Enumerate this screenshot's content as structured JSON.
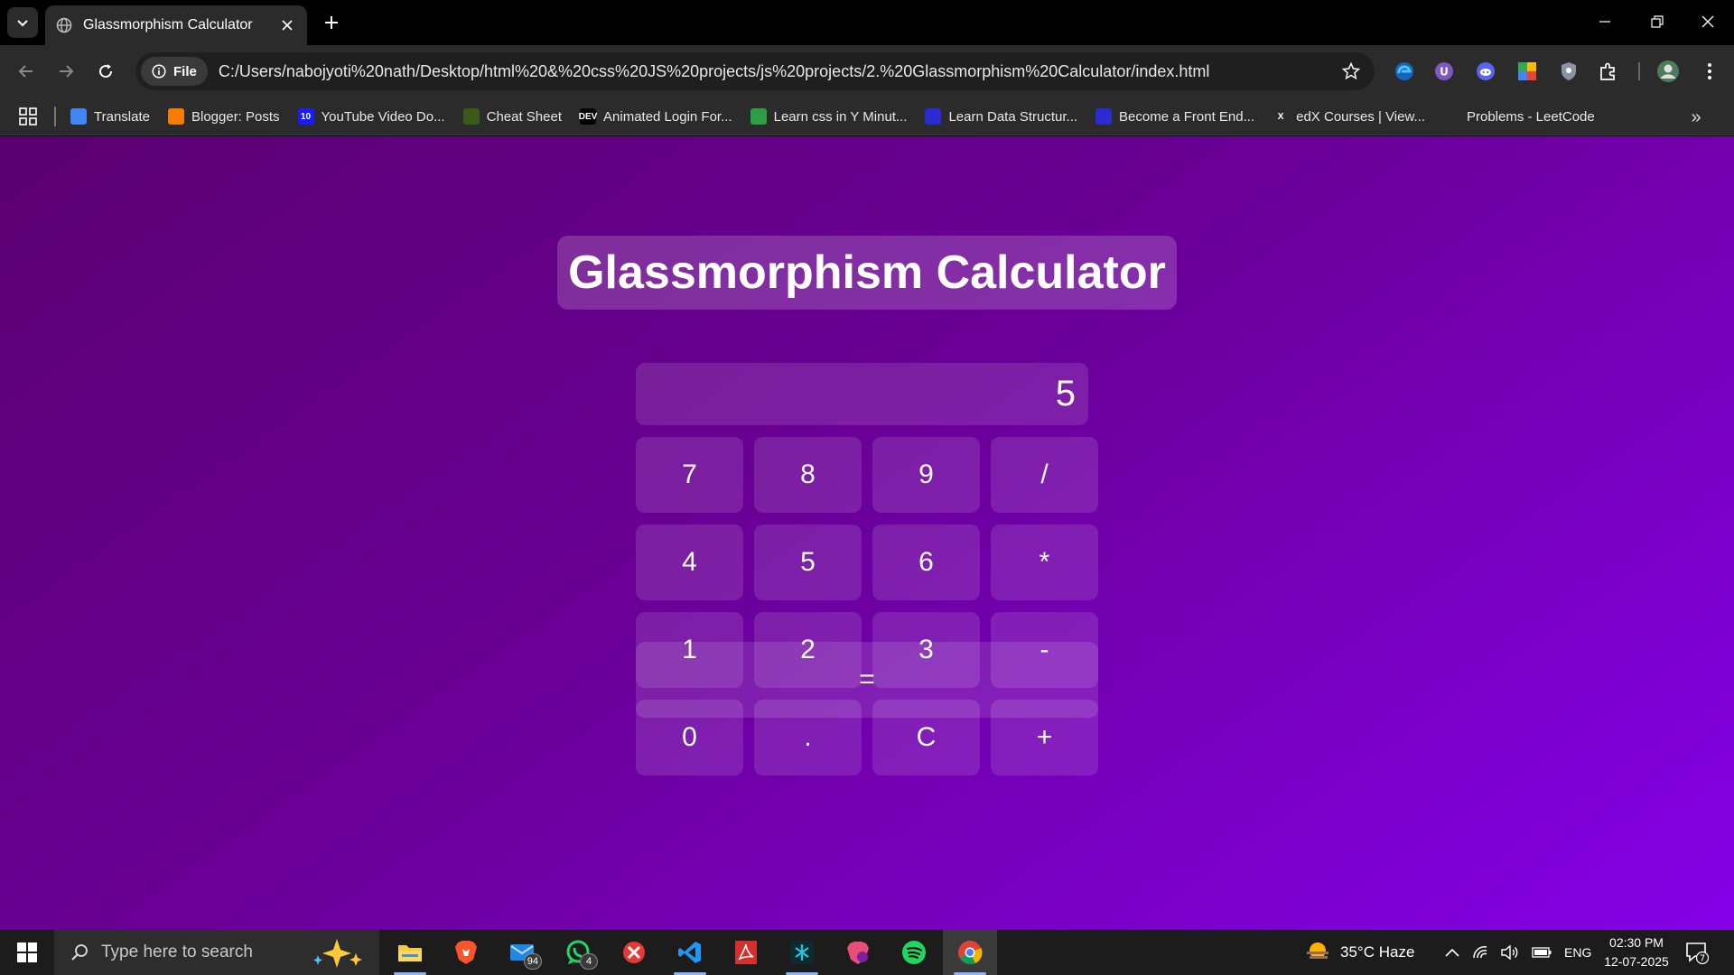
{
  "browser": {
    "tab_title": "Glassmorphism Calculator",
    "site_chip": "File",
    "url": "C:/Users/nabojyoti%20nath/Desktop/html%20&%20css%20JS%20projects/js%20projects/2.%20Glassmorphism%20Calculator/index.html",
    "bookmarks": [
      {
        "label": "Translate",
        "icon": "google-translate-icon",
        "color": "#4285f4"
      },
      {
        "label": "Blogger: Posts",
        "icon": "blogger-icon",
        "color": "#f57d00"
      },
      {
        "label": "YouTube Video Do...",
        "icon": "youtube-downloader-icon",
        "color": "#1a1aff",
        "glyph": "10"
      },
      {
        "label": "Cheat Sheet",
        "icon": "cheat-sheet-icon",
        "color": "#3a5a1a"
      },
      {
        "label": "Animated Login For...",
        "icon": "dev-icon",
        "color": "#000000",
        "glyph": "DEV"
      },
      {
        "label": "Learn css in Y Minut...",
        "icon": "learnxiny-icon",
        "color": "#2e9e44"
      },
      {
        "label": "Learn Data Structur...",
        "icon": "data-structures-icon",
        "color": "#2b2bd4"
      },
      {
        "label": "Become a Front End...",
        "icon": "frontend-icon",
        "color": "#2b2bd4"
      },
      {
        "label": "edX Courses | View...",
        "icon": "edx-icon",
        "color": "#2b2b2b",
        "glyph": "X"
      },
      {
        "label": "Problems - LeetCode",
        "icon": "leetcode-icon",
        "color": "#2b2b2b"
      }
    ]
  },
  "page": {
    "heading": "Glassmorphism Calculator",
    "display_value": "5",
    "keys": [
      "7",
      "8",
      "9",
      "/",
      "4",
      "5",
      "6",
      "*",
      "1",
      "2",
      "3",
      "-",
      "0",
      ".",
      "C",
      "+"
    ],
    "equals": "="
  },
  "taskbar": {
    "search_placeholder": "Type here to search",
    "badges": {
      "mail": "94",
      "whatsapp": "4"
    },
    "weather": "35°C  Haze",
    "lang": "ENG",
    "time": "02:30 PM",
    "date": "12-07-2025",
    "notifications": "7"
  },
  "colors": {
    "page_gradient_start": "#5a0070",
    "page_gradient_end": "#8500e8",
    "chrome_bg": "#2b2b2b"
  }
}
